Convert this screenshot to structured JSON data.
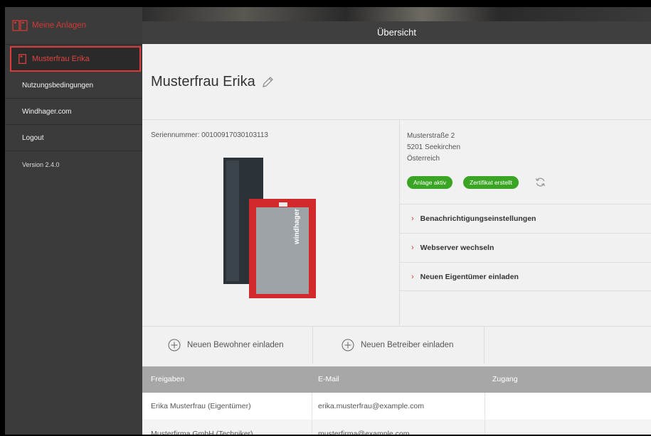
{
  "sidebar": {
    "top_label": "Meine Anlagen",
    "active_label": "Musterfrau Erika",
    "items": [
      "Nutzungsbedingungen",
      "Windhager.com",
      "Logout"
    ],
    "version": "Version 2.4.0"
  },
  "header": {
    "title": "Übersicht"
  },
  "main": {
    "title": "Musterfrau Erika",
    "serial": "Seriennummer: 00100917030103113",
    "address": [
      "Musterstraße 2",
      "5201 Seekirchen",
      "Österreich"
    ],
    "badges": [
      "Anlage aktiv",
      "Zertifikat erstellt"
    ],
    "actions": [
      "Benachrichtigungseinstellungen",
      "Webserver wechseln",
      "Neuen Eigentümer einladen"
    ],
    "invite": [
      "Neuen Bewohner einladen",
      "Neuen Betreiber einladen"
    ],
    "product_brand": "windhager"
  },
  "table": {
    "headers": [
      "Freigaben",
      "E-Mail",
      "Zugang"
    ],
    "rows": [
      [
        "Erika Musterfrau (Eigentümer)",
        "erika.musterfrau@example.com",
        ""
      ],
      [
        "Musterfirma GmbH (Techniker)",
        "musterfirma@example.com",
        ""
      ]
    ]
  },
  "colors": {
    "accent": "#e0393a",
    "success": "#3aa524",
    "sidebar": "#3b3b3b",
    "table_header": "#a7a7a7"
  }
}
